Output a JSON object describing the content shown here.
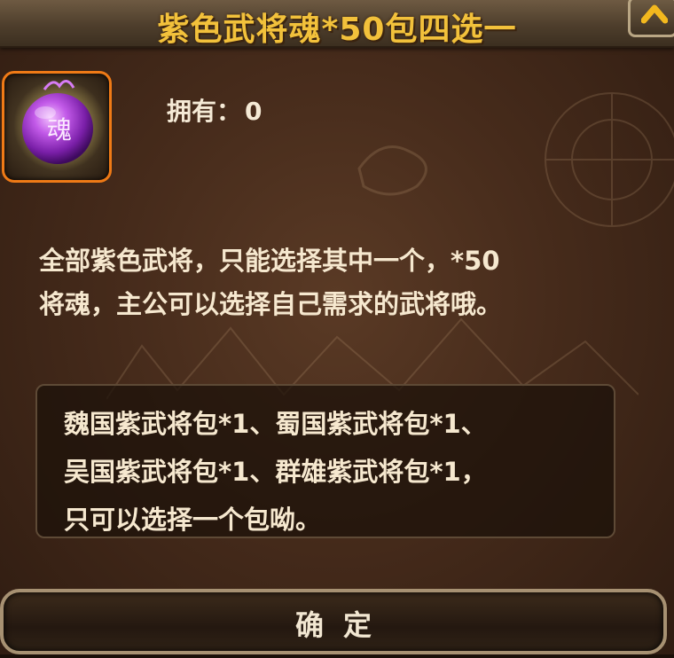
{
  "dialog": {
    "title": "紫色武将魂*50包四选一",
    "close_icon": "chevron-up-icon"
  },
  "item": {
    "icon": "purple-soul-orb-icon",
    "orb_glyph": "魂",
    "owned_label": "拥有：",
    "owned_count": "0"
  },
  "description": {
    "line1": "全部紫色武将，只能选择其中一个，*50",
    "line2": "将魂，主公可以选择自己需求的武将哦。"
  },
  "info": {
    "line1": "魏国紫武将包*1、蜀国紫武将包*1、",
    "line2": "吴国紫武将包*1、群雄紫武将包*1，",
    "line3": "只可以选择一个包呦。"
  },
  "confirm": {
    "label": "确定"
  },
  "colors": {
    "title": "#f2c13b",
    "slot_border": "#ef7a16",
    "text": "#f6e8cf",
    "orb": "#b64de0"
  }
}
